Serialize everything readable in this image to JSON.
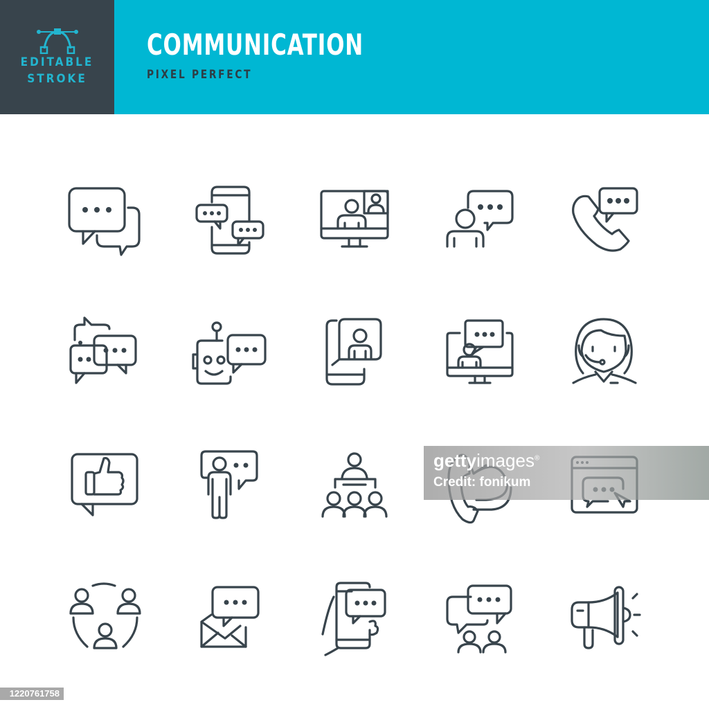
{
  "header": {
    "badge_line1": "EDITABLE",
    "badge_line2": "STROKE",
    "title": "COMMUNICATION",
    "subtitle": "PIXEL PERFECT",
    "colors": {
      "badge_bg": "#38444c",
      "badge_text": "#22b5cf",
      "banner_bg": "#00b7d3",
      "title": "#ffffff",
      "subtitle": "#2e3d45"
    }
  },
  "icon_color": "#38444c",
  "icons": [
    {
      "row": 1,
      "col": 1,
      "name": "chat-bubbles"
    },
    {
      "row": 1,
      "col": 2,
      "name": "mobile-chat"
    },
    {
      "row": 1,
      "col": 3,
      "name": "video-conference"
    },
    {
      "row": 1,
      "col": 4,
      "name": "person-speech-bubble"
    },
    {
      "row": 1,
      "col": 5,
      "name": "phone-chat"
    },
    {
      "row": 2,
      "col": 1,
      "name": "group-chat"
    },
    {
      "row": 2,
      "col": 2,
      "name": "chatbot"
    },
    {
      "row": 2,
      "col": 3,
      "name": "contact-book"
    },
    {
      "row": 2,
      "col": 4,
      "name": "online-consultation"
    },
    {
      "row": 2,
      "col": 5,
      "name": "support-operator"
    },
    {
      "row": 3,
      "col": 1,
      "name": "like-message"
    },
    {
      "row": 3,
      "col": 2,
      "name": "speaker-presentation"
    },
    {
      "row": 3,
      "col": 3,
      "name": "seminar"
    },
    {
      "row": 3,
      "col": 4,
      "name": "call-back"
    },
    {
      "row": 3,
      "col": 5,
      "name": "web-chat"
    },
    {
      "row": 4,
      "col": 1,
      "name": "people-network"
    },
    {
      "row": 4,
      "col": 2,
      "name": "email-message"
    },
    {
      "row": 4,
      "col": 3,
      "name": "hand-smartphone-chat"
    },
    {
      "row": 4,
      "col": 4,
      "name": "team-discussion"
    },
    {
      "row": 4,
      "col": 5,
      "name": "megaphone"
    }
  ],
  "watermark": {
    "brand_bold": "getty",
    "brand_light": "images",
    "registered": "®",
    "credit": "Credit: fonikum"
  },
  "image_id": "1220761758"
}
